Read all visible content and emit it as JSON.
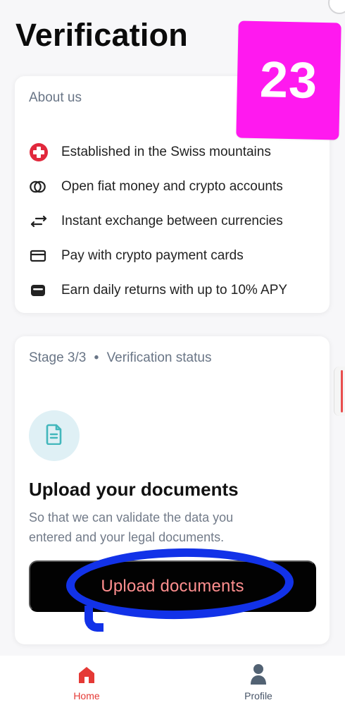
{
  "header": {
    "title": "Verification"
  },
  "overlay": {
    "badge_number": "23",
    "badge_color": "#ff19ef",
    "annotation_color": "#1232e8"
  },
  "about": {
    "title": "About us",
    "items": [
      {
        "icon": "swiss-cross-icon",
        "label": "Established in the Swiss mountains"
      },
      {
        "icon": "accounts-icon",
        "label": "Open fiat money and crypto accounts"
      },
      {
        "icon": "exchange-icon",
        "label": "Instant exchange between currencies"
      },
      {
        "icon": "card-icon",
        "label": "Pay with crypto payment cards"
      },
      {
        "icon": "wallet-icon",
        "label": "Earn daily returns with up to 10% APY"
      }
    ]
  },
  "verification": {
    "stage": "Stage 3/3",
    "separator": "•",
    "status": "Verification status",
    "document_icon": "document-icon",
    "heading": "Upload your documents",
    "description": "So that we can validate the data you entered and your legal documents.",
    "button_label": "Upload documents"
  },
  "bottom_nav": {
    "items": [
      {
        "label": "Home",
        "icon": "home-icon",
        "active": true
      },
      {
        "label": "Profile",
        "icon": "profile-icon",
        "active": false
      }
    ]
  },
  "colors": {
    "accent_red": "#e53935",
    "swiss_red": "#e1283c",
    "document_teal": "#42b7bc",
    "button_background": "#020202",
    "button_text": "#ff8f8f",
    "muted_text": "#697586"
  }
}
